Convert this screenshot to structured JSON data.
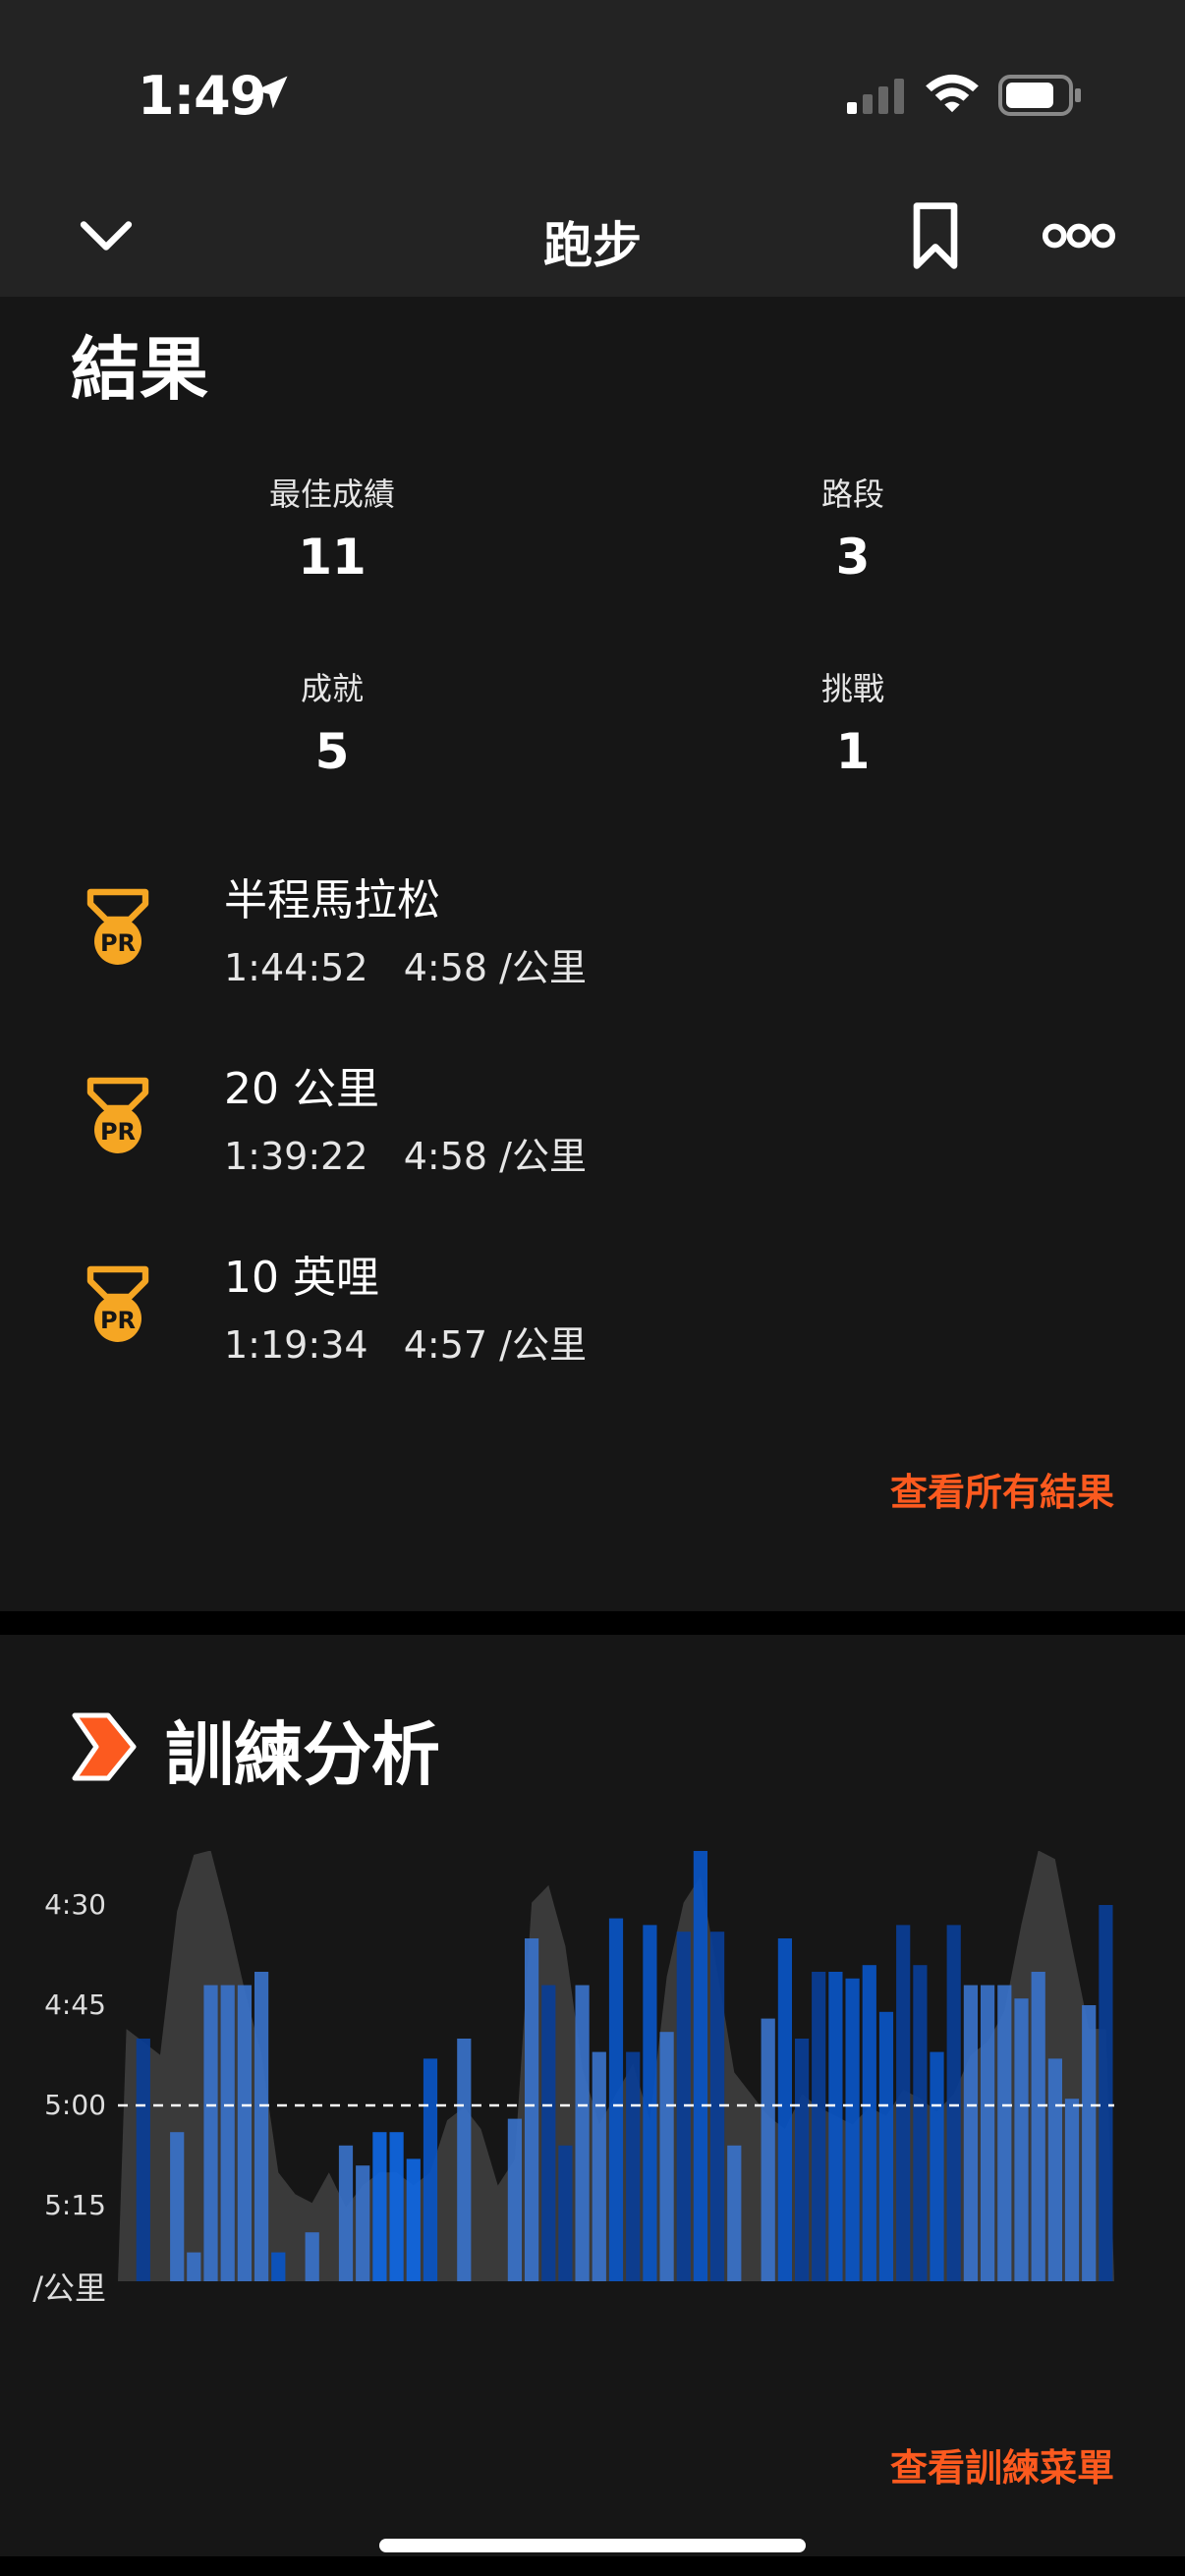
{
  "status_bar": {
    "time": "1:49"
  },
  "nav": {
    "title": "跑步"
  },
  "results": {
    "title": "結果",
    "stats": [
      {
        "label": "最佳成績",
        "value": "11"
      },
      {
        "label": "路段",
        "value": "3"
      },
      {
        "label": "成就",
        "value": "5"
      },
      {
        "label": "挑戰",
        "value": "1"
      }
    ],
    "prs": [
      {
        "badge": "PR",
        "name": "半程馬拉松",
        "time": "1:44:52",
        "pace": "4:58 /公里"
      },
      {
        "badge": "PR",
        "name": "20 公里",
        "time": "1:39:22",
        "pace": "4:58 /公里"
      },
      {
        "badge": "PR",
        "name": "10 英哩",
        "time": "1:19:34",
        "pace": "4:57 /公里"
      }
    ],
    "view_all": "查看所有結果"
  },
  "training": {
    "title": "訓練分析",
    "view_menu": "查看訓練菜單"
  },
  "colors": {
    "accent": "#fc5a1f",
    "medal": "#f5a623",
    "bar_light": "#3a72c9",
    "bar_mid": "#0a55c4",
    "bar_dark": "#0a3e96",
    "bar_bright": "#0f67e3",
    "elevation": "#3a3a3a"
  },
  "chart_data": {
    "type": "bar",
    "ylabel": "/公里",
    "yticks": [
      "4:30",
      "4:45",
      "5:00",
      "5:15"
    ],
    "y_reversed": true,
    "reference_line": "5:00",
    "pace_seconds": [
      331,
      290,
      331,
      304,
      322,
      282,
      282,
      282,
      280,
      322,
      344,
      319,
      331,
      306,
      309,
      304,
      304,
      308,
      293,
      327,
      290,
      337,
      337,
      302,
      275,
      282,
      306,
      282,
      292,
      272,
      292,
      273,
      289,
      274,
      257,
      274,
      306,
      329,
      287,
      275,
      290,
      280,
      280,
      281,
      279,
      286,
      273,
      279,
      292,
      273,
      282,
      282,
      282,
      284,
      280,
      293,
      299,
      285,
      270
    ],
    "elevation_series": [
      0.58,
      0.55,
      0.52,
      0.85,
      0.98,
      0.99,
      0.84,
      0.67,
      0.52,
      0.25,
      0.2,
      0.18,
      0.25,
      0.17,
      0.22,
      0.25,
      0.25,
      0.22,
      0.25,
      0.37,
      0.4,
      0.35,
      0.22,
      0.28,
      0.87,
      0.91,
      0.77,
      0.49,
      0.36,
      0.43,
      0.5,
      0.37,
      0.7,
      0.87,
      0.93,
      0.71,
      0.48,
      0.43,
      0.38,
      0.35,
      0.43,
      0.4,
      0.38,
      0.36,
      0.4,
      0.38,
      0.44,
      0.42,
      0.39,
      0.43,
      0.52,
      0.55,
      0.62,
      0.82,
      0.99,
      0.97,
      0.77,
      0.58,
      0.58
    ],
    "colors_index": [
      0,
      2,
      0,
      0,
      0,
      0,
      0,
      0,
      0,
      1,
      0,
      0,
      0,
      0,
      0,
      3,
      3,
      3,
      1,
      0,
      0,
      0,
      0,
      0,
      0,
      2,
      2,
      0,
      0,
      1,
      2,
      1,
      0,
      2,
      1,
      2,
      0,
      0,
      0,
      1,
      2,
      2,
      1,
      1,
      1,
      1,
      2,
      2,
      1,
      2,
      0,
      0,
      0,
      0,
      0,
      0,
      0,
      0,
      2
    ]
  }
}
